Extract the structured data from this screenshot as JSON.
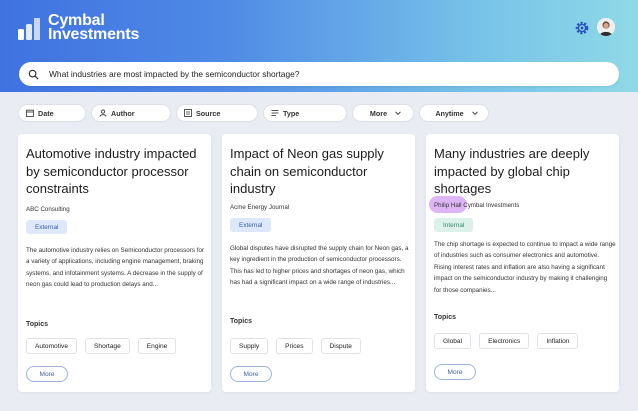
{
  "app": {
    "name_line1": "Cymbal",
    "name_line2": "Investments"
  },
  "search": {
    "query": "What industries are most impacted by the semiconductor shortage?"
  },
  "filters": [
    {
      "label": "Date",
      "icon": "calendar-icon"
    },
    {
      "label": "Author",
      "icon": "person-icon"
    },
    {
      "label": "Source",
      "icon": "source-icon"
    },
    {
      "label": "Type",
      "icon": "type-icon"
    },
    {
      "label": "More",
      "icon": "chevron-down-icon"
    },
    {
      "label": "Anytime",
      "icon": "chevron-down-icon"
    }
  ],
  "cards": [
    {
      "title": "Automotive industry impacted by semiconductor processor constraints",
      "source": "ABC Consulting",
      "badge": "External",
      "body": "The automotive industry relies on Semiconductor processors for a variety of applications, including engine management, braking systems, and infotainment systems. A decrease in the supply of neon gas could lead to production delays and...",
      "topics_label": "Topics",
      "topics": [
        "Automotive",
        "Shortage",
        "Engine"
      ],
      "more_label": "More"
    },
    {
      "title": "Impact of Neon gas supply chain on semiconductor industry",
      "source": "Acme Energy Journal",
      "badge": "External",
      "body": "Global disputes have disrupted the supply chain for Neon gas, a key ingredient in the production of semiconductor processors. This has led to higher prices and shortages of neon gas, which has had a significant impact on a wide range of industries...",
      "topics_label": "Topics",
      "topics": [
        "Supply",
        "Prices",
        "Dispute"
      ],
      "more_label": "More"
    },
    {
      "title": "Many industries are deeply impacted by global chip shortages",
      "author": "Philip Hall",
      "source": "Cymbal Investments",
      "badge": "Internal",
      "body": "The chip shortage is expected to continue to impact a wide range of industries such as consumer electronics and automotive. Rising interest rates and inflation are also having a significant impact on the semiconductor industry by making it challenging for those companies...",
      "topics_label": "Topics",
      "topics": [
        "Global",
        "Electronics",
        "Inflation"
      ],
      "more_label": "More"
    }
  ],
  "colors": {
    "external_badge_bg": "#dde8fb",
    "internal_badge_bg": "#dcf1ea",
    "highlight": "#c578ee"
  }
}
